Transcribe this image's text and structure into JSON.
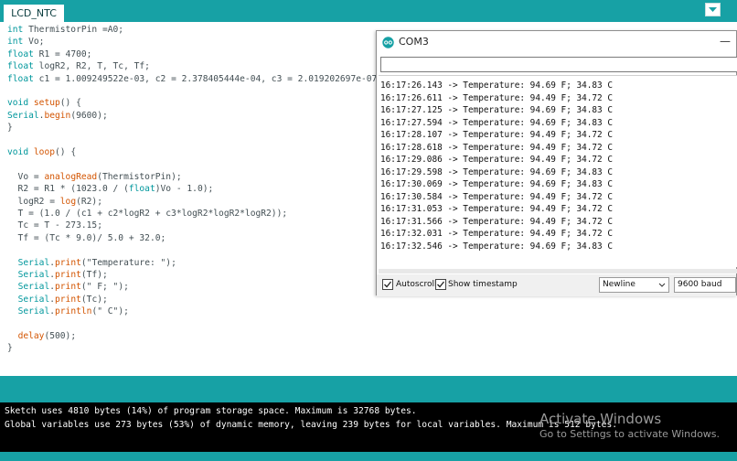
{
  "tab": {
    "label": "LCD_NTC"
  },
  "code": {
    "lines": [
      [
        {
          "t": "int",
          "c": "kw"
        },
        {
          "t": " ThermistorPin =A0;"
        }
      ],
      [
        {
          "t": "int",
          "c": "kw"
        },
        {
          "t": " Vo;"
        }
      ],
      [
        {
          "t": "float",
          "c": "kw"
        },
        {
          "t": " R1 = 4700;"
        }
      ],
      [
        {
          "t": "float",
          "c": "kw"
        },
        {
          "t": " logR2, R2, T, Tc, Tf;"
        }
      ],
      [
        {
          "t": "float",
          "c": "kw"
        },
        {
          "t": " c1 = 1.009249522e-03, c2 = 2.378405444e-04, c3 = 2.019202697e-07;"
        }
      ],
      [],
      [
        {
          "t": "void",
          "c": "kw"
        },
        {
          "t": " "
        },
        {
          "t": "setup",
          "c": "fn"
        },
        {
          "t": "() {"
        }
      ],
      [
        {
          "t": "Serial",
          "c": "kw"
        },
        {
          "t": "."
        },
        {
          "t": "begin",
          "c": "fn"
        },
        {
          "t": "(9600);"
        }
      ],
      [
        {
          "t": "}"
        }
      ],
      [],
      [
        {
          "t": "void",
          "c": "kw"
        },
        {
          "t": " "
        },
        {
          "t": "loop",
          "c": "fn"
        },
        {
          "t": "() {"
        }
      ],
      [],
      [
        {
          "t": "  Vo = "
        },
        {
          "t": "analogRead",
          "c": "fn"
        },
        {
          "t": "(ThermistorPin);"
        }
      ],
      [
        {
          "t": "  R2 = R1 * (1023.0 / ("
        },
        {
          "t": "float",
          "c": "kw"
        },
        {
          "t": ")Vo - 1.0);"
        }
      ],
      [
        {
          "t": "  logR2 = "
        },
        {
          "t": "log",
          "c": "fn"
        },
        {
          "t": "(R2);"
        }
      ],
      [
        {
          "t": "  T = (1.0 / (c1 + c2*logR2 + c3*logR2*logR2*logR2));"
        }
      ],
      [
        {
          "t": "  Tc = T - 273.15;"
        }
      ],
      [
        {
          "t": "  Tf = (Tc * 9.0)/ 5.0 + 32.0;"
        }
      ],
      [],
      [
        {
          "t": "  "
        },
        {
          "t": "Serial",
          "c": "kw"
        },
        {
          "t": "."
        },
        {
          "t": "print",
          "c": "fn"
        },
        {
          "t": "(\"Temperature: \");"
        }
      ],
      [
        {
          "t": "  "
        },
        {
          "t": "Serial",
          "c": "kw"
        },
        {
          "t": "."
        },
        {
          "t": "print",
          "c": "fn"
        },
        {
          "t": "(Tf);"
        }
      ],
      [
        {
          "t": "  "
        },
        {
          "t": "Serial",
          "c": "kw"
        },
        {
          "t": "."
        },
        {
          "t": "print",
          "c": "fn"
        },
        {
          "t": "(\" F; \");"
        }
      ],
      [
        {
          "t": "  "
        },
        {
          "t": "Serial",
          "c": "kw"
        },
        {
          "t": "."
        },
        {
          "t": "print",
          "c": "fn"
        },
        {
          "t": "(Tc);"
        }
      ],
      [
        {
          "t": "  "
        },
        {
          "t": "Serial",
          "c": "kw"
        },
        {
          "t": "."
        },
        {
          "t": "println",
          "c": "fn"
        },
        {
          "t": "(\" C\");"
        }
      ],
      [],
      [
        {
          "t": "  "
        },
        {
          "t": "delay",
          "c": "fn"
        },
        {
          "t": "(500);"
        }
      ],
      [
        {
          "t": "}"
        }
      ]
    ]
  },
  "serial_monitor": {
    "title": "COM3",
    "minimize": "—",
    "input_value": "",
    "lines": [
      "16:17:26.143 -> Temperature: 94.69 F; 34.83 C",
      "16:17:26.611 -> Temperature: 94.49 F; 34.72 C",
      "16:17:27.125 -> Temperature: 94.69 F; 34.83 C",
      "16:17:27.594 -> Temperature: 94.69 F; 34.83 C",
      "16:17:28.107 -> Temperature: 94.49 F; 34.72 C",
      "16:17:28.618 -> Temperature: 94.49 F; 34.72 C",
      "16:17:29.086 -> Temperature: 94.49 F; 34.72 C",
      "16:17:29.598 -> Temperature: 94.69 F; 34.83 C",
      "16:17:30.069 -> Temperature: 94.69 F; 34.83 C",
      "16:17:30.584 -> Temperature: 94.49 F; 34.72 C",
      "16:17:31.053 -> Temperature: 94.49 F; 34.72 C",
      "16:17:31.566 -> Temperature: 94.49 F; 34.72 C",
      "16:17:32.031 -> Temperature: 94.49 F; 34.72 C",
      "16:17:32.546 -> Temperature: 94.69 F; 34.83 C"
    ],
    "autoscroll_label": "Autoscroll",
    "autoscroll_checked": true,
    "timestamp_label": "Show timestamp",
    "timestamp_checked": true,
    "line_ending": "Newline",
    "baud": "9600 baud"
  },
  "console": {
    "lines": [
      "Sketch uses 4810 bytes (14%) of program storage space. Maximum is 32768 bytes.",
      "Global variables use 273 bytes (53%) of dynamic memory, leaving 239 bytes for local variables. Maximum is 512 bytes."
    ]
  },
  "watermark": {
    "title": "Activate Windows",
    "subtitle": "Go to Settings to activate Windows."
  },
  "colors": {
    "teal": "#17a1a5",
    "keyword": "#00979c",
    "function": "#d35400"
  },
  "icons": {
    "tab_menu": "chevron-down-icon",
    "serial_logo": "arduino-logo-icon",
    "checkbox": "checkmark-icon",
    "dropdown": "chevron-down-icon"
  }
}
